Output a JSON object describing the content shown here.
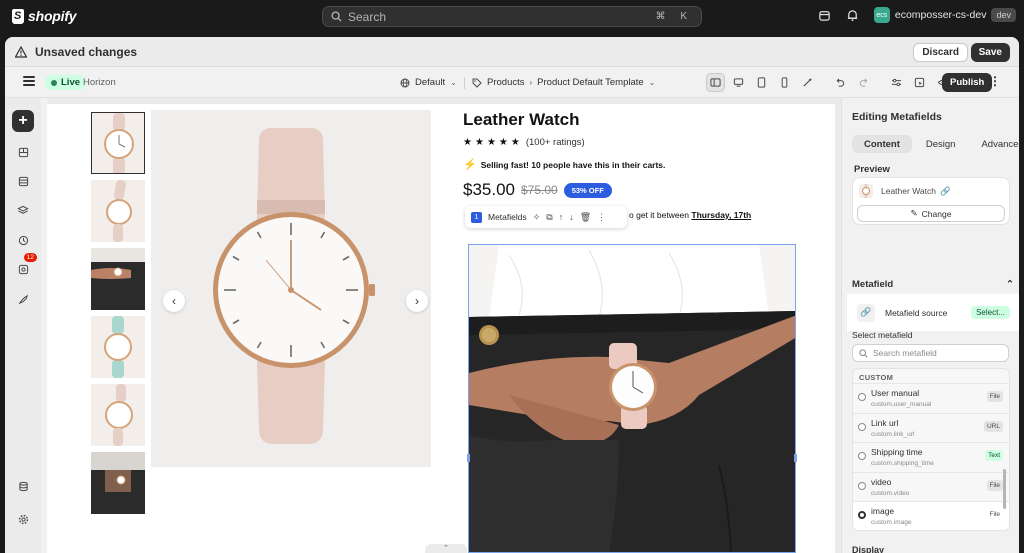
{
  "topbar": {
    "brand": "shopify",
    "search_placeholder": "Search",
    "shortcut": "⌘ K",
    "store_initials": "ecs",
    "store_name": "ecomposser-cs-dev",
    "store_badge": "dev"
  },
  "savebar": {
    "message": "Unsaved changes",
    "discard_label": "Discard",
    "save_label": "Save"
  },
  "editor": {
    "live_label": "Live",
    "theme_name": "Horizon",
    "context_default": "Default",
    "context_resource": "Products",
    "context_template": "Product Default Template",
    "publish_label": "Publish"
  },
  "rail": {
    "notification_count": "12"
  },
  "product": {
    "title": "Leather Watch",
    "rating_text": "(100+ ratings)",
    "stars": 5,
    "urgency": "Selling fast! 10 people have this in their carts.",
    "price": "$35.00",
    "compare_price": "$75.00",
    "discount_badge": "53% OFF",
    "delivery_prefix": "o get it between",
    "delivery_date": "Thursday, 17th",
    "toolbar_label": "Metafields",
    "toolbar_index": "1"
  },
  "panel": {
    "title": "Editing Metafields",
    "tabs": [
      "Content",
      "Design",
      "Advanced"
    ],
    "preview_label": "Preview",
    "preview_product": "Leather Watch",
    "change_label": "Change",
    "metafield_heading": "Metafield",
    "source_label": "Metafield source",
    "source_action": "Select...",
    "select_label": "Select metafield",
    "search_placeholder": "Search metafield",
    "group_label": "CUSTOM",
    "items": [
      {
        "name": "User manual",
        "key": "custom.user_manual",
        "type": "File",
        "selected": false
      },
      {
        "name": "Link url",
        "key": "custom.link_url",
        "type": "URL",
        "selected": false
      },
      {
        "name": "Shipping time",
        "key": "custom.shipping_time",
        "type": "Text",
        "selected": false
      },
      {
        "name": "video",
        "key": "custom.video",
        "type": "File",
        "selected": false
      },
      {
        "name": "image",
        "key": "custom.image",
        "type": "File",
        "selected": true
      }
    ],
    "display_label": "Display"
  },
  "colors": {
    "accent_blue": "#2c5ce0",
    "live_green": "#cdfee1",
    "badge_red": "#e51c00"
  }
}
